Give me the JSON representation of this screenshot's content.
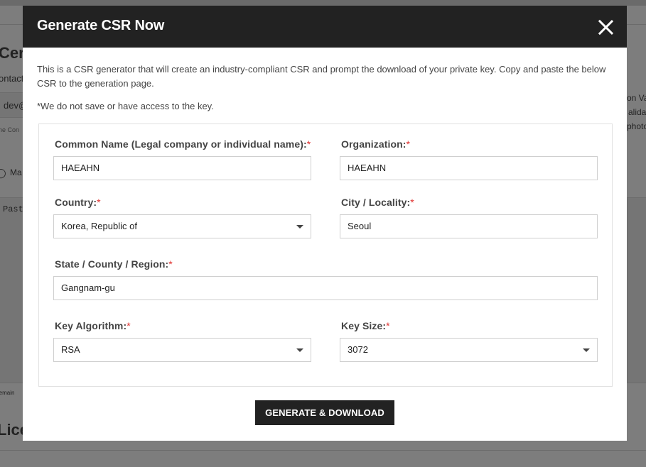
{
  "background": {
    "heading_fragment": "Cert",
    "contact_fragment": "ontact",
    "email_fragment": "dev@",
    "hint_fragment": "ne Con",
    "radio_fragment": "Ma",
    "paste_fragment": "Past",
    "remain_fragment": "remain",
    "license_fragment": "Lice",
    "right_line1": "on Va",
    "right_line2": "alida",
    "right_line3": "photo"
  },
  "modal": {
    "title": "Generate CSR Now",
    "intro": "This is a CSR generator that will create an industry-compliant CSR and prompt the download of your private key. Copy and paste the below CSR to the generation page.",
    "note": "*We do not save or have access to the key.",
    "required_mark": "*",
    "fields": {
      "common_name": {
        "label": "Common Name (Legal company or individual name):",
        "value": "HAEAHN"
      },
      "organization": {
        "label": "Organization:",
        "value": "HAEAHN"
      },
      "country": {
        "label": "Country:",
        "value": "Korea, Republic of"
      },
      "city": {
        "label": "City / Locality:",
        "value": "Seoul"
      },
      "state": {
        "label": "State / County / Region:",
        "value": "Gangnam-gu"
      },
      "key_algorithm": {
        "label": "Key Algorithm:",
        "value": "RSA"
      },
      "key_size": {
        "label": "Key Size:",
        "value": "3072"
      }
    },
    "submit_label": "GENERATE & DOWNLOAD"
  },
  "icons": {
    "close": "close-icon",
    "dropdown": "chevron-down-icon"
  },
  "colors": {
    "header_bg": "#222222",
    "required": "#e0312f",
    "button_bg": "#222222"
  }
}
